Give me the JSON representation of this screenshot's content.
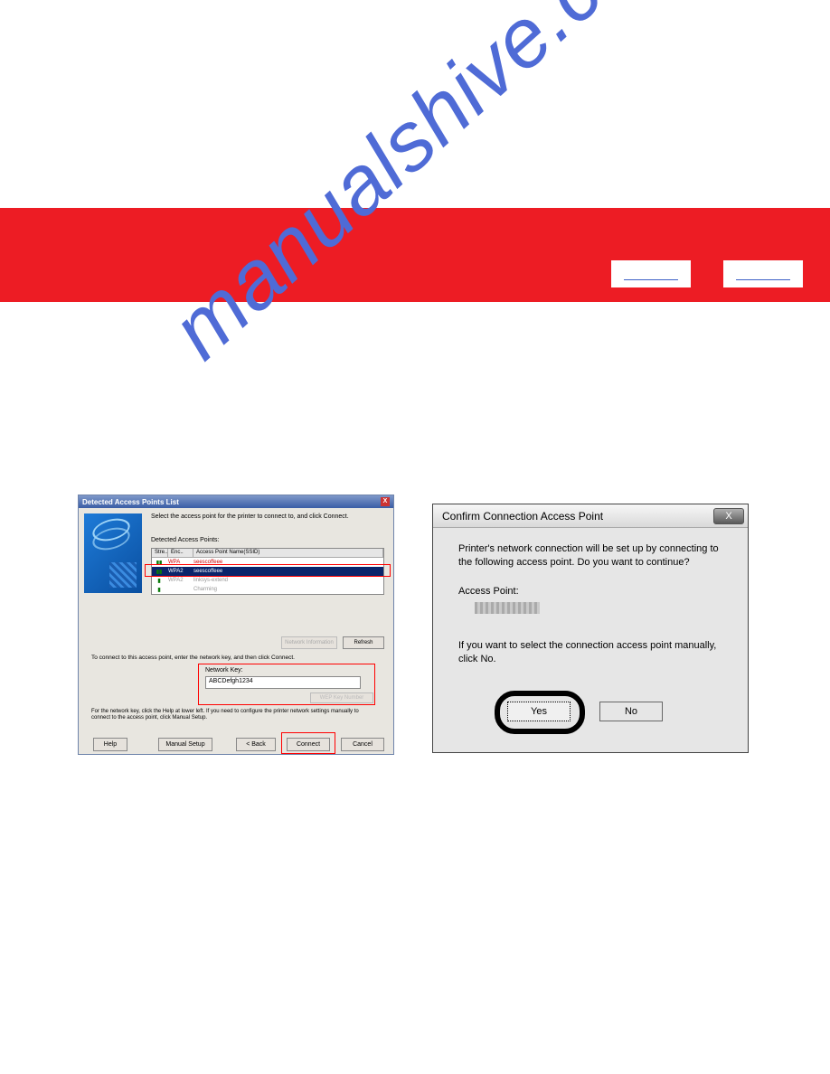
{
  "watermark": "manualshive.com",
  "header": {
    "nav_button1": "",
    "nav_button2": ""
  },
  "left_dialog": {
    "title": "Detected Access Points List",
    "close_x": "X",
    "instruction": "Select the access point for the printer to connect to, and click Connect.",
    "list_label": "Detected Access Points:",
    "columns": {
      "c1": "Stre..",
      "c2": "Enc..",
      "c3": "Access Point Name(SSID)"
    },
    "rows": [
      {
        "sig": "▮▮",
        "enc": "WPA",
        "name": "seescoffeee"
      },
      {
        "sig": "▮▮",
        "enc": "WPA2",
        "name": "seescoffeee"
      },
      {
        "sig": "▮",
        "enc": "WPA2",
        "name": "linksys-extend"
      },
      {
        "sig": "▮",
        "enc": "",
        "name": "Charming"
      }
    ],
    "network_info_btn": "Network Information",
    "refresh_btn": "Refresh",
    "connect_msg": "To connect to this access point, enter the network key, and then click Connect.",
    "network_key_label": "Network Key:",
    "network_key_value": "ABCDefgh1234",
    "wep_btn": "WEP Key Number",
    "note": "For the network key, click the Help at lower left.\nIf you need to configure the printer network settings manually to connect to the access point, click Manual Setup.",
    "btn_help": "Help",
    "btn_manual": "Manual Setup",
    "btn_back": "< Back",
    "btn_connect": "Connect",
    "btn_cancel": "Cancel"
  },
  "right_dialog": {
    "title": "Confirm Connection Access Point",
    "close_x": "X",
    "msg": "Printer's network connection will be set up by connecting to the following access point. Do you want to continue?",
    "ap_label": "Access Point:",
    "msg2": "If you want to select the connection access point manually, click No.",
    "btn_yes": "Yes",
    "btn_no": "No"
  }
}
